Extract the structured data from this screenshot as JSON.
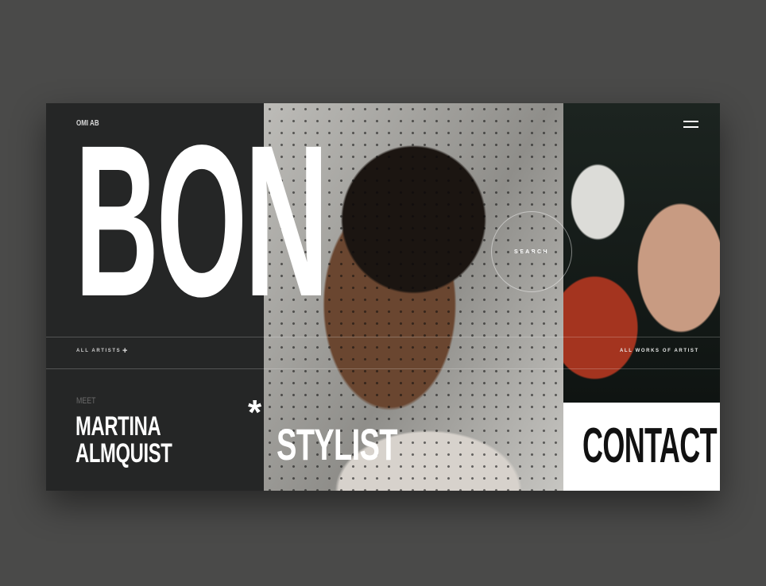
{
  "header": {
    "brand": "OMI AB",
    "menu_icon": "hamburger-menu-icon"
  },
  "hero": {
    "title": "BON"
  },
  "nav": {
    "all_artists": "ALL ARTISTS",
    "plus_icon": "+",
    "search": "SEARCH",
    "all_works": "ALL WORKS OF ARTIST"
  },
  "feature": {
    "meet": "MEET",
    "name_line1": "MARTINA",
    "name_line2": "ALMQUIST",
    "asterisk": "*",
    "role": "STYLIST"
  },
  "contact": {
    "label": "CONTACT"
  },
  "colors": {
    "background": "#4a4a49",
    "panel": "#252626",
    "text": "#ffffff",
    "contact_bg": "#ffffff",
    "contact_text": "#111111"
  }
}
